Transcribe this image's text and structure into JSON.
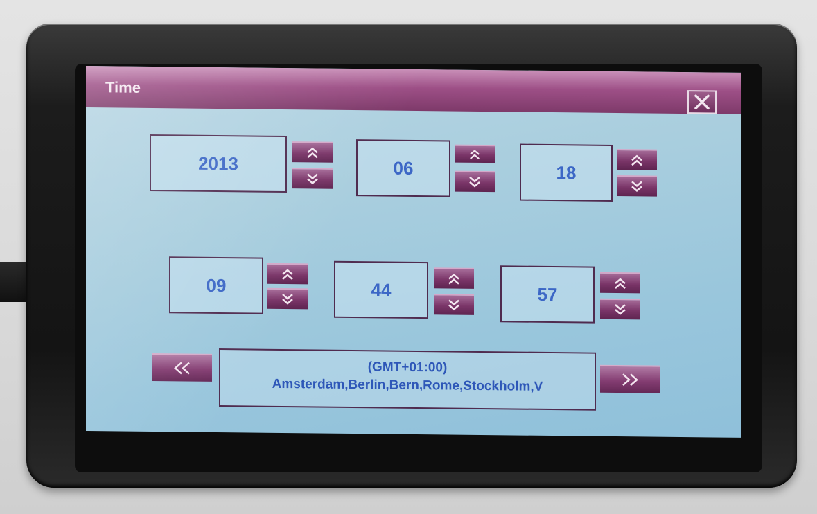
{
  "window": {
    "title": "Time"
  },
  "date": {
    "year": "2013",
    "month": "06",
    "day": "18"
  },
  "time": {
    "hour": "09",
    "minute": "44",
    "second": "57"
  },
  "timezone": {
    "offset": "(GMT+01:00)",
    "cities": "Amsterdam,Berlin,Bern,Rome,Stockholm,V"
  },
  "icons": {
    "close": "close-icon",
    "increment": "chevron-double-up-icon",
    "decrement": "chevron-double-down-icon",
    "previous": "chevron-double-left-icon",
    "next": "chevron-double-right-icon"
  },
  "colors": {
    "accent": "#7e3a6a",
    "value_text": "#3c67c6",
    "screen_bg": "#a9cede"
  }
}
